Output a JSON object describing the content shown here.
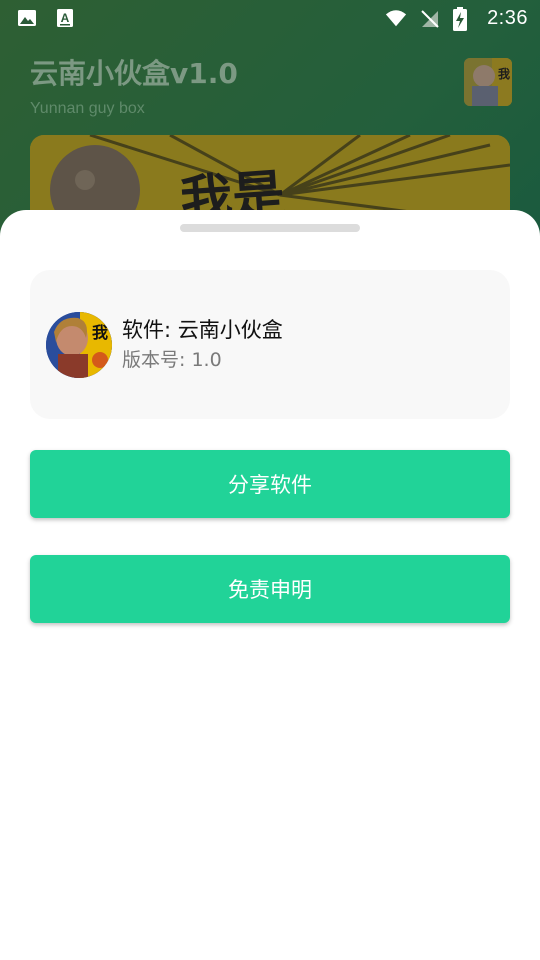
{
  "status_bar": {
    "time": "2:36",
    "left_icons": [
      "image-icon",
      "font-a-icon"
    ],
    "right_icons": [
      "wifi-icon",
      "no-signal-icon",
      "battery-charging-icon"
    ]
  },
  "app": {
    "title": "云南小伙盒v1.0",
    "subtitle": "Yunnan guy box",
    "banner_text": "我是"
  },
  "sheet": {
    "software_label": "软件: 云南小伙盒",
    "version_label": "版本号: 1.0",
    "share_button": "分享软件",
    "disclaimer_button": "免责申明"
  },
  "colors": {
    "accent": "#21d398",
    "sheet_bg": "#ffffff",
    "card_bg": "#f8f8f8",
    "scrim_green": "#1f6a44"
  }
}
